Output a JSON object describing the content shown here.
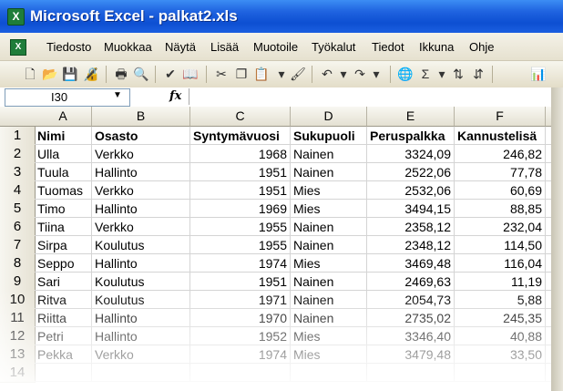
{
  "window": {
    "title": "Microsoft Excel - palkat2.xls"
  },
  "menu": {
    "items": [
      "Tiedosto",
      "Muokkaa",
      "Näytä",
      "Lisää",
      "Muotoile",
      "Työkalut",
      "Tiedot",
      "Ikkuna",
      "Ohje"
    ]
  },
  "formula_bar": {
    "name_box": "I30",
    "fx": "fx",
    "content": ""
  },
  "toolbar": {
    "icons": [
      "new-document-icon",
      "open-folder-icon",
      "save-icon",
      "permission-icon",
      "print-icon",
      "print-preview-icon",
      "spelling-icon",
      "research-icon",
      "cut-icon",
      "copy-icon",
      "paste-icon",
      "format-painter-icon",
      "undo-icon",
      "redo-icon",
      "hyperlink-icon",
      "autosum-icon",
      "sort-ascending-icon",
      "sort-descending-icon",
      "chart-wizard-icon"
    ]
  },
  "sheet": {
    "columns": [
      "A",
      "B",
      "C",
      "D",
      "E",
      "F"
    ],
    "rows": [
      {
        "num": "1",
        "cells": [
          "Nimi",
          "Osasto",
          "Syntymävuosi",
          "Sukupuoli",
          "Peruspalkka",
          "Kannustelisä"
        ]
      },
      {
        "num": "2",
        "cells": [
          "Ulla",
          "Verkko",
          "1968",
          "Nainen",
          "3324,09",
          "246,82"
        ]
      },
      {
        "num": "3",
        "cells": [
          "Tuula",
          "Hallinto",
          "1951",
          "Nainen",
          "2522,06",
          "77,78"
        ]
      },
      {
        "num": "4",
        "cells": [
          "Tuomas",
          "Verkko",
          "1951",
          "Mies",
          "2532,06",
          "60,69"
        ]
      },
      {
        "num": "5",
        "cells": [
          "Timo",
          "Hallinto",
          "1969",
          "Mies",
          "3494,15",
          "88,85"
        ]
      },
      {
        "num": "6",
        "cells": [
          "Tiina",
          "Verkko",
          "1955",
          "Nainen",
          "2358,12",
          "232,04"
        ]
      },
      {
        "num": "7",
        "cells": [
          "Sirpa",
          "Koulutus",
          "1955",
          "Nainen",
          "2348,12",
          "114,50"
        ]
      },
      {
        "num": "8",
        "cells": [
          "Seppo",
          "Hallinto",
          "1974",
          "Mies",
          "3469,48",
          "116,04"
        ]
      },
      {
        "num": "9",
        "cells": [
          "Sari",
          "Koulutus",
          "1951",
          "Nainen",
          "2469,63",
          "11,19"
        ]
      },
      {
        "num": "10",
        "cells": [
          "Ritva",
          "Koulutus",
          "1971",
          "Nainen",
          "2054,73",
          "5,88"
        ]
      },
      {
        "num": "11",
        "cells": [
          "Riitta",
          "Hallinto",
          "1970",
          "Nainen",
          "2735,02",
          "245,35"
        ]
      },
      {
        "num": "12",
        "cells": [
          "Petri",
          "Hallinto",
          "1952",
          "Mies",
          "3346,40",
          "40,88"
        ]
      },
      {
        "num": "13",
        "cells": [
          "Pekka",
          "Verkko",
          "1974",
          "Mies",
          "3479,48",
          "33,50"
        ]
      },
      {
        "num": "14",
        "cells": [
          "",
          "",
          "",
          "",
          "",
          ""
        ]
      }
    ]
  }
}
